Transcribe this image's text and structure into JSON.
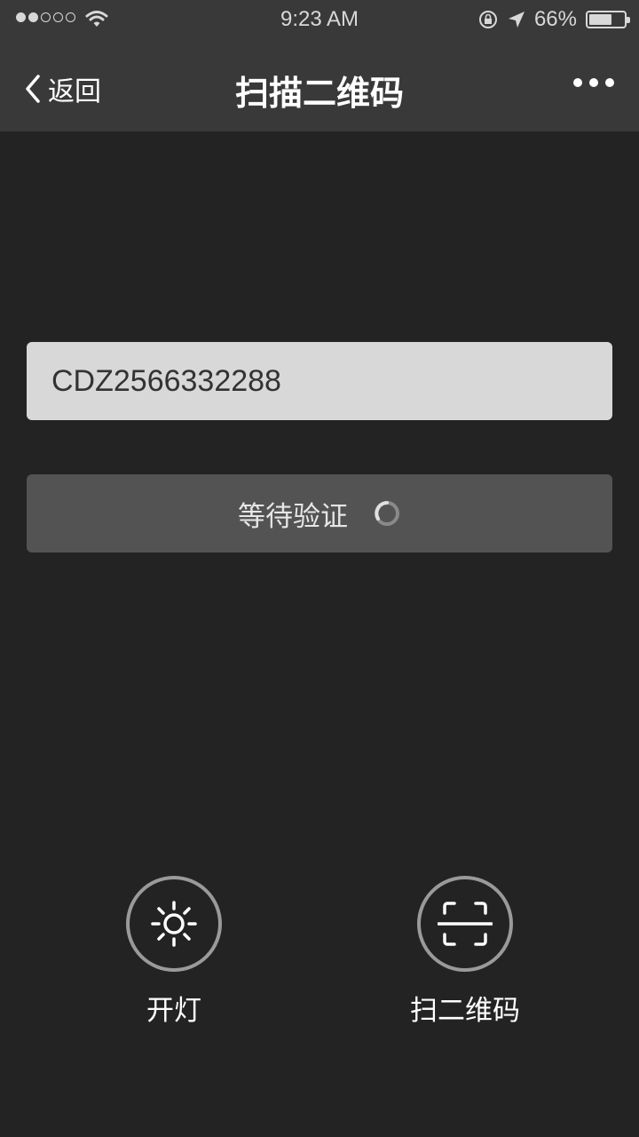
{
  "status_bar": {
    "time": "9:23 AM",
    "battery_percent": "66%",
    "battery_level": 0.66,
    "signal_bars_filled": 2,
    "signal_bars_total": 5
  },
  "nav": {
    "back_label": "返回",
    "title": "扫描二维码"
  },
  "code_field": {
    "value": "CDZ2566332288"
  },
  "verify_button": {
    "label": "等待验证"
  },
  "actions": {
    "light_label": "开灯",
    "scan_label": "扫二维码"
  },
  "colors": {
    "background": "#232323",
    "nav_background": "#393939",
    "field_background": "#d8d8d8",
    "button_background": "#535353",
    "circle_border": "#9a9a9a"
  }
}
